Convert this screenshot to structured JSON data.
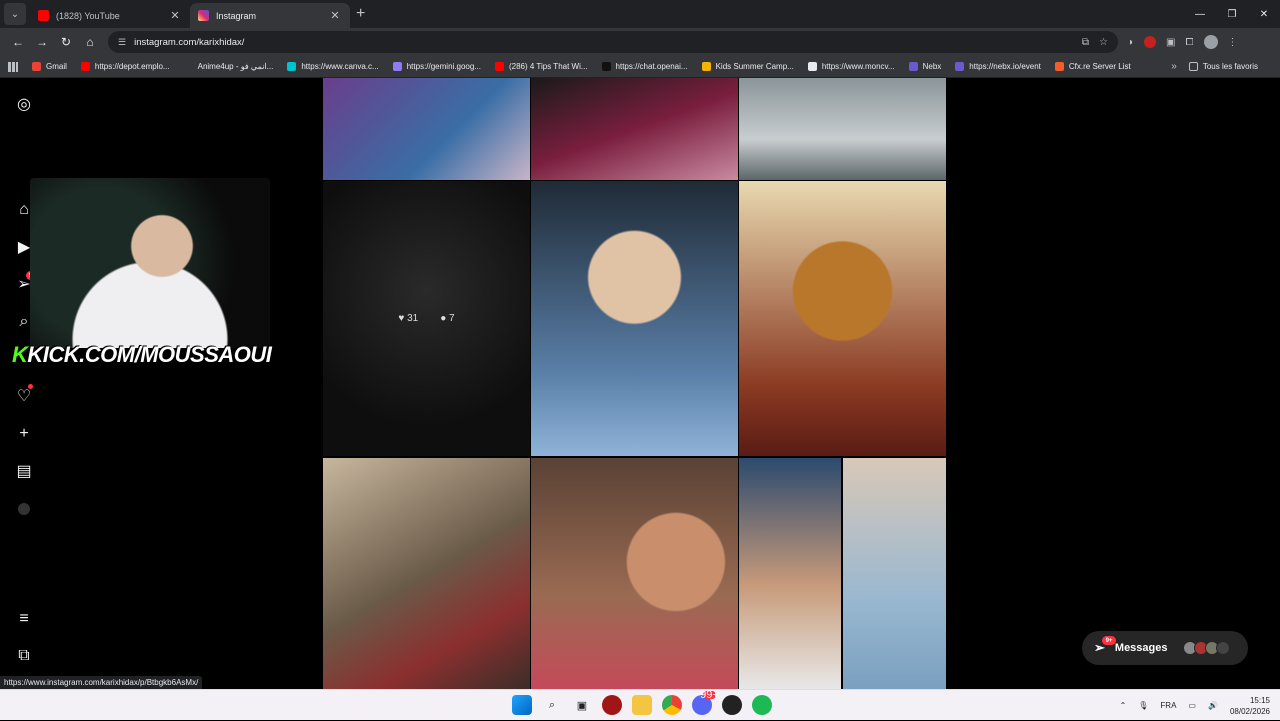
{
  "tabs": [
    {
      "title": "(1828) YouTube",
      "color": "#ff0000",
      "active": false
    },
    {
      "title": "Instagram",
      "color": "#d62976",
      "active": true
    }
  ],
  "address": {
    "url": "instagram.com/karixhidax/"
  },
  "bookmarks": [
    {
      "label": "Gmail",
      "color": "#ea4335"
    },
    {
      "label": "https://depot.emplo...",
      "color": "#ff0000"
    },
    {
      "label": "Anime4up - انمي فو...",
      "color": "#35363a"
    },
    {
      "label": "https://www.canva.c...",
      "color": "#00c4cc"
    },
    {
      "label": "https://gemini.goog...",
      "color": "#8e7cf0"
    },
    {
      "label": "(286) 4 Tips That Wi...",
      "color": "#ff0000"
    },
    {
      "label": "https://chat.openai...",
      "color": "#111111"
    },
    {
      "label": "Kids Summer Camp...",
      "color": "#f4b400"
    },
    {
      "label": "https://www.moncv...",
      "color": "#e8eaed"
    },
    {
      "label": "Nebx",
      "color": "#6a5acd"
    },
    {
      "label": "https://nebx.io/event",
      "color": "#6a5acd"
    },
    {
      "label": "Cfx.re Server List",
      "color": "#f25d2b"
    }
  ],
  "bookmarks_all": "Tous les favoris",
  "overlay": {
    "brand": "K",
    "text": "KICK.COM/MOUSSAOUI"
  },
  "hovered_post": {
    "likes": "31",
    "comments": "7"
  },
  "nav_badge": "9",
  "messages": {
    "label": "Messages",
    "badge": "9+"
  },
  "status_url": "https://www.instagram.com/karixhidax/p/Btbgkb6AsMx/",
  "taskbar": {
    "lang": "FRA",
    "time": "15:15",
    "date": "08/02/2026",
    "chrome_badge": "99+"
  }
}
